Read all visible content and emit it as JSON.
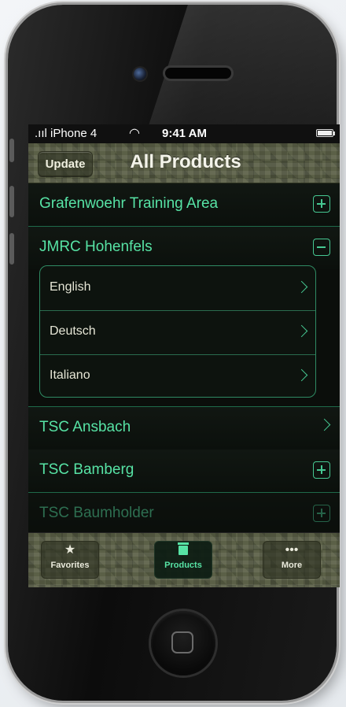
{
  "status_bar": {
    "carrier": ".ııl iPhone 4",
    "time": "9:41 AM",
    "battery_level": 1.0
  },
  "nav_bar": {
    "update_label": "Update",
    "title": "All Products"
  },
  "list": {
    "rows": [
      {
        "label": "Grafenwoehr Training Area",
        "accessory": "plus-icon"
      },
      {
        "label": "JMRC Hohenfels",
        "accessory": "minus-icon"
      },
      {
        "label": "TSC Ansbach",
        "accessory": "chevron-right-icon"
      },
      {
        "label": "TSC Bamberg",
        "accessory": "plus-icon"
      },
      {
        "label": "TSC Baumholder",
        "accessory": "plus-icon"
      }
    ],
    "expanded_children": [
      {
        "label": "English",
        "accessory": "chevron-right-icon"
      },
      {
        "label": "Deutsch",
        "accessory": "chevron-right-icon"
      },
      {
        "label": "Italiano",
        "accessory": "chevron-right-icon"
      }
    ]
  },
  "tab_bar": {
    "tabs": [
      {
        "label": "Favorites",
        "icon": "star-icon",
        "glyph": "★",
        "active": false
      },
      {
        "label": "Products",
        "icon": "products-icon",
        "glyph": "",
        "active": true
      },
      {
        "label": "More",
        "icon": "more-icon",
        "glyph": "•••",
        "active": false
      }
    ]
  },
  "colors": {
    "accent": "#57e3a5",
    "row_background": "#0b100c",
    "camo": "#5b6047"
  }
}
